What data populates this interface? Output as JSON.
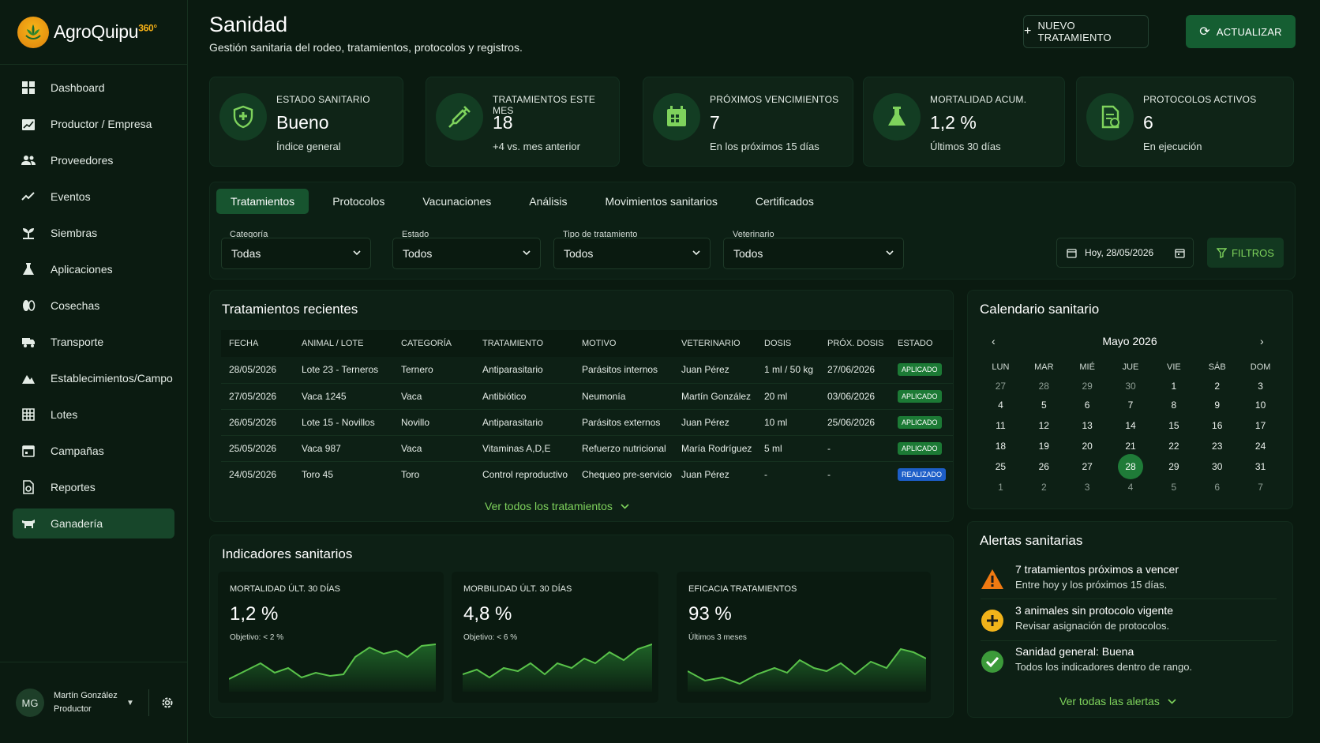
{
  "app": {
    "name": "AgroQuipu",
    "badge": "360°"
  },
  "sidebar": {
    "items": [
      {
        "label": "Dashboard",
        "icon": "grid-icon"
      },
      {
        "label": "Productor / Empresa",
        "icon": "building-chart-icon"
      },
      {
        "label": "Proveedores",
        "icon": "people-icon"
      },
      {
        "label": "Eventos",
        "icon": "trend-icon"
      },
      {
        "label": "Siembras",
        "icon": "sprout-icon"
      },
      {
        "label": "Aplicaciones",
        "icon": "flask-icon"
      },
      {
        "label": "Cosechas",
        "icon": "grain-icon"
      },
      {
        "label": "Transporte",
        "icon": "truck-icon"
      },
      {
        "label": "Establecimientos/Campo",
        "icon": "mountain-icon"
      },
      {
        "label": "Lotes",
        "icon": "table-grid-icon"
      },
      {
        "label": "Campañas",
        "icon": "calendar-icon"
      },
      {
        "label": "Reportes",
        "icon": "report-icon"
      },
      {
        "label": "Ganadería",
        "icon": "cow-icon",
        "active": true
      }
    ]
  },
  "user": {
    "initials": "MG",
    "name": "Martín González",
    "role": "Productor"
  },
  "header": {
    "title": "Sanidad",
    "subtitle": "Gestión sanitaria del rodeo, tratamientos, protocolos y registros.",
    "new_label": "NUEVO TRATAMIENTO",
    "update_label": "ACTUALIZAR"
  },
  "kpis": [
    {
      "label": "ESTADO SANITARIO",
      "value": "Bueno",
      "sub": "Índice general",
      "icon": "shield-plus-icon"
    },
    {
      "label": "TRATAMIENTOS ESTE MES",
      "value": "18",
      "sub": "+4 vs. mes anterior",
      "icon": "syringe-icon"
    },
    {
      "label": "PRÓXIMOS VENCIMIENTOS",
      "value": "7",
      "sub": "En los próximos 15 días",
      "icon": "calendar-icon"
    },
    {
      "label": "MORTALIDAD ACUM.",
      "value": "1,2 %",
      "sub": "Últimos 30 días",
      "icon": "flask-icon"
    },
    {
      "label": "PROTOCOLOS ACTIVOS",
      "value": "6",
      "sub": "En ejecución",
      "icon": "document-check-icon"
    }
  ],
  "tabs": [
    "Tratamientos",
    "Protocolos",
    "Vacunaciones",
    "Análisis",
    "Movimientos sanitarios",
    "Certificados"
  ],
  "filters": {
    "categoria": {
      "label": "Categoría",
      "value": "Todas"
    },
    "estado": {
      "label": "Estado",
      "value": "Todos"
    },
    "tipo": {
      "label": "Tipo de tratamiento",
      "value": "Todos"
    },
    "veterinario": {
      "label": "Veterinario",
      "value": "Todos"
    },
    "date": "Hoy, 28/05/2026",
    "filters_label": "FILTROS"
  },
  "treatments": {
    "title": "Tratamientos recientes",
    "columns": [
      "FECHA",
      "ANIMAL / LOTE",
      "CATEGORÍA",
      "TRATAMIENTO",
      "MOTIVO",
      "VETERINARIO",
      "DOSIS",
      "PRÓX. DOSIS",
      "ESTADO"
    ],
    "rows": [
      [
        "28/05/2026",
        "Lote 23 - Terneros",
        "Ternero",
        "Antiparasitario",
        "Parásitos internos",
        "Juan Pérez",
        "1 ml / 50 kg",
        "27/06/2026",
        "APLICADO"
      ],
      [
        "27/05/2026",
        "Vaca 1245",
        "Vaca",
        "Antibiótico",
        "Neumonía",
        "Martín González",
        "20 ml",
        "03/06/2026",
        "APLICADO"
      ],
      [
        "26/05/2026",
        "Lote 15 - Novillos",
        "Novillo",
        "Antiparasitario",
        "Parásitos externos",
        "Juan Pérez",
        "10 ml",
        "25/06/2026",
        "APLICADO"
      ],
      [
        "25/05/2026",
        "Vaca 987",
        "Vaca",
        "Vitaminas A,D,E",
        "Refuerzo nutricional",
        "María Rodríguez",
        "5 ml",
        "-",
        "APLICADO"
      ],
      [
        "24/05/2026",
        "Toro 45",
        "Toro",
        "Control reproductivo",
        "Chequeo pre-servicio",
        "Juan Pérez",
        "-",
        "-",
        "REALIZADO"
      ]
    ],
    "view_all": "Ver todos los tratamientos"
  },
  "indicators": {
    "title": "Indicadores sanitarios",
    "items": [
      {
        "label": "MORTALIDAD ÚLT. 30 DÍAS",
        "value": "1,2 %",
        "sub": "Objetivo: < 2 %"
      },
      {
        "label": "MORBILIDAD ÚLT. 30 DÍAS",
        "value": "4,8 %",
        "sub": "Objetivo: < 6 %"
      },
      {
        "label": "EFICACIA TRATAMIENTOS",
        "value": "93 %",
        "sub": "Últimos 3 meses"
      }
    ]
  },
  "calendar": {
    "title": "Calendario sanitario",
    "month": "Mayo 2026",
    "weekdays": [
      "LUN",
      "MAR",
      "MIÉ",
      "JUE",
      "VIE",
      "SÁB",
      "DOM"
    ],
    "weeks": [
      [
        "27",
        "28",
        "29",
        "30",
        "1",
        "2",
        "3"
      ],
      [
        "4",
        "5",
        "6",
        "7",
        "8",
        "9",
        "10"
      ],
      [
        "11",
        "12",
        "13",
        "14",
        "15",
        "16",
        "17"
      ],
      [
        "18",
        "19",
        "20",
        "21",
        "22",
        "23",
        "24"
      ],
      [
        "25",
        "26",
        "27",
        "28",
        "29",
        "30",
        "31"
      ],
      [
        "1",
        "2",
        "3",
        "4",
        "5",
        "6",
        "7"
      ]
    ],
    "today": "28"
  },
  "alerts": {
    "title": "Alertas sanitarias",
    "items": [
      {
        "title": "7 tratamientos próximos a vencer",
        "sub": "Entre hoy y los próximos 15 días.",
        "icon": "warning-icon",
        "color": "#f07a12"
      },
      {
        "title": "3 animales sin protocolo vigente",
        "sub": "Revisar asignación de protocolos.",
        "icon": "plus-circle-icon",
        "color": "#f2b31a"
      },
      {
        "title": "Sanidad general: Buena",
        "sub": "Todos los indicadores dentro de rango.",
        "icon": "check-circle-icon",
        "color": "#3c9a3a"
      }
    ],
    "view_all": "Ver todas las alertas"
  },
  "colors": {
    "accent": "#7ed25c",
    "primary": "#155e32",
    "applied": "#1c7a35",
    "done": "#1d5ec8"
  }
}
